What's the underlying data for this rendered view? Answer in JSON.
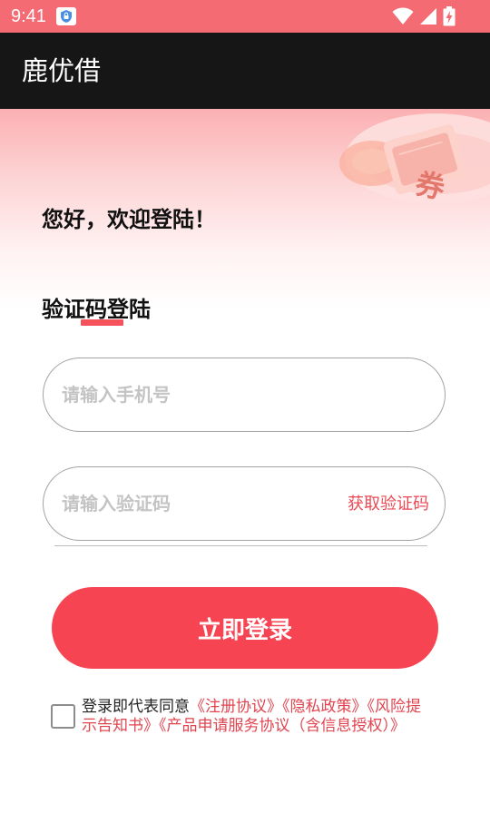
{
  "status_bar": {
    "time": "9:41",
    "app_icon": "shield-icon",
    "icons": [
      "wifi-icon",
      "cellular-signal-icon",
      "battery-charging-icon"
    ]
  },
  "app_bar": {
    "title": "鹿优借"
  },
  "hero": {
    "decoration": "coupon-illustration",
    "decoration_text": "券"
  },
  "greeting": "您好，欢迎登陆！",
  "login_mode": "验证码登陆",
  "phone_input": {
    "value": "",
    "placeholder": "请输入手机号"
  },
  "code_input": {
    "value": "",
    "placeholder": "请输入验证码",
    "get_code_label": "获取验证码"
  },
  "login_button_label": "立即登录",
  "agreement": {
    "checked": false,
    "prefix": "登录即代表同意",
    "links": [
      "《注册协议》",
      "《隐私政策》",
      "《风险提示告知书》",
      "《产品申请服务协议（含信息授权）》"
    ]
  },
  "colors": {
    "status_bar": "#f46b73",
    "app_bar": "#161616",
    "accent": "#f74452",
    "link": "#e0444f"
  }
}
